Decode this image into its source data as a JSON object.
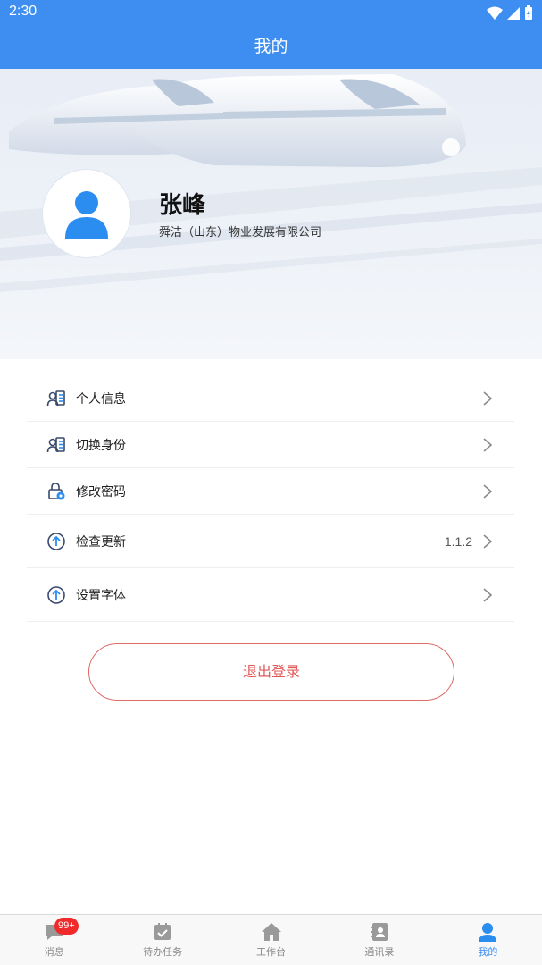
{
  "status_bar": {
    "time": "2:30"
  },
  "app_bar": {
    "title": "我的"
  },
  "profile": {
    "name": "张峰",
    "company": "舜洁（山东）物业发展有限公司"
  },
  "menu": {
    "items": [
      {
        "label": "个人信息",
        "icon": "id-card-icon",
        "value": ""
      },
      {
        "label": "切换身份",
        "icon": "id-card-icon",
        "value": ""
      },
      {
        "label": "修改密码",
        "icon": "lock-icon",
        "value": ""
      },
      {
        "label": "检查更新",
        "icon": "arrow-up-circle-icon",
        "value": "1.1.2"
      },
      {
        "label": "设置字体",
        "icon": "arrow-up-circle-icon",
        "value": ""
      }
    ]
  },
  "logout": {
    "label": "退出登录"
  },
  "tabbar": {
    "tabs": [
      {
        "label": "消息",
        "icon": "message-icon",
        "badge": "99+"
      },
      {
        "label": "待办任务",
        "icon": "calendar-check-icon"
      },
      {
        "label": "工作台",
        "icon": "home-icon"
      },
      {
        "label": "通讯录",
        "icon": "contacts-icon"
      },
      {
        "label": "我的",
        "icon": "user-icon",
        "active": true
      }
    ]
  },
  "colors": {
    "primary": "#3d8ef0",
    "logout": "#e05a5a",
    "badge": "#f02a2a"
  }
}
